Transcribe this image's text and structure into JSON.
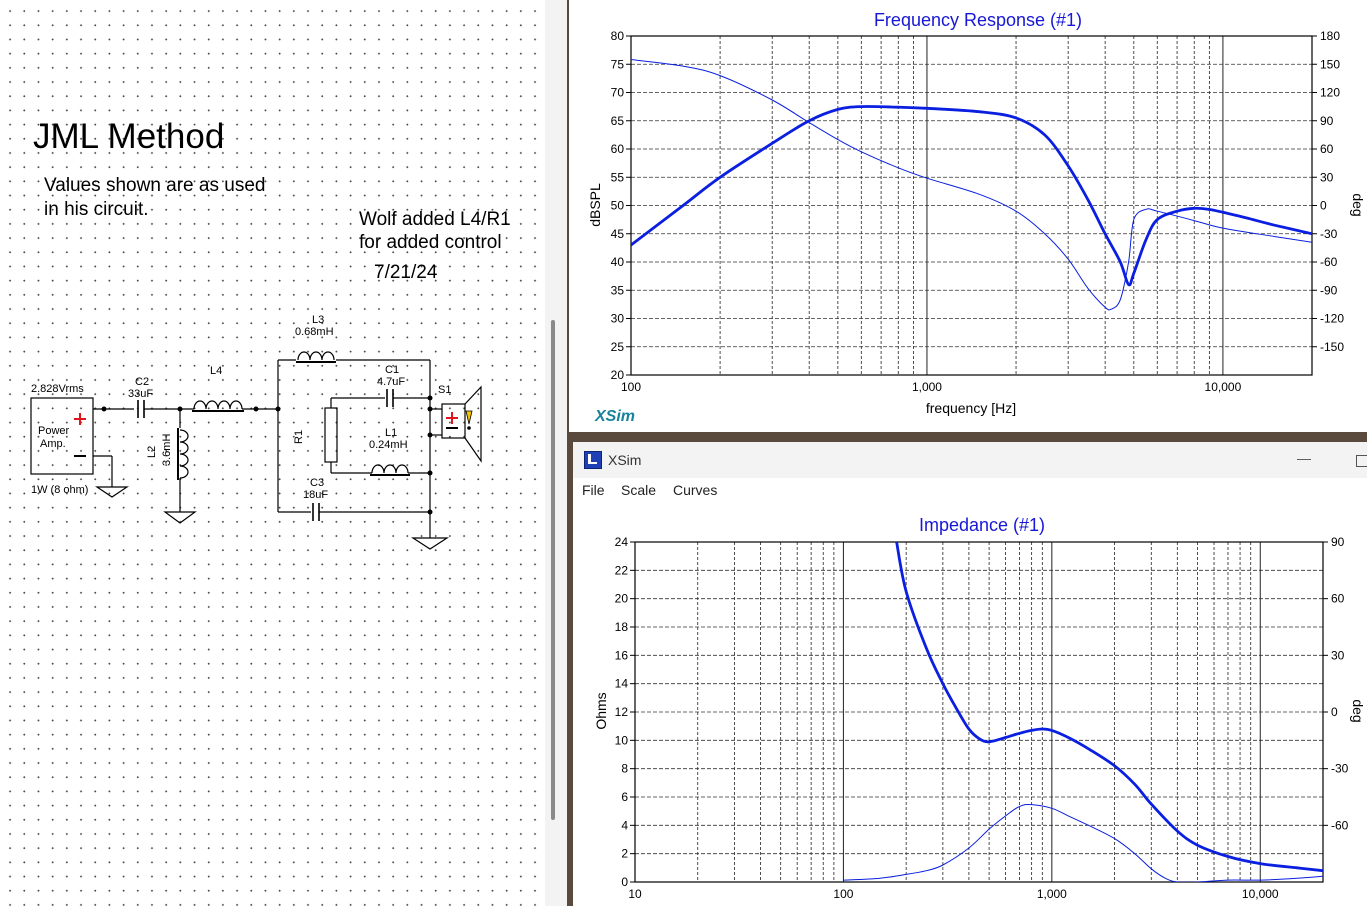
{
  "schematic": {
    "title": "JML Method",
    "note_line1": "Values shown are as used",
    "note_line2": "in his circuit.",
    "note2_line1": "Wolf added L4/R1",
    "note2_line2": "for added control",
    "date": "7/21/24",
    "source_voltage": "2.828Vrms",
    "source_label_line1": "Power",
    "source_label_line2": "Amp.",
    "source_power": "1W (8 ohm)",
    "c2_name": "C2",
    "c2_value": "33uF",
    "l4_name": "L4",
    "l2_name": "L2",
    "l2_value": "3.6mH",
    "r1_name": "R1",
    "l3_name": "L3",
    "l3_value": "0.68mH",
    "c1_name": "C1",
    "c1_value": "4.7uF",
    "l1_name": "L1",
    "l1_value": "0.24mH",
    "c3_name": "C3",
    "c3_value": "18uF",
    "s1_name": "S1"
  },
  "frequency_response": {
    "title": "Frequency Response (#1)",
    "ylabel_left": "dBSPL",
    "ylabel_right": "deg",
    "xlabel": "frequency [Hz]",
    "brand": "XSim",
    "y_ticks": [
      "80",
      "75",
      "70",
      "65",
      "60",
      "55",
      "50",
      "45",
      "40",
      "35",
      "30",
      "25",
      "20"
    ],
    "y2_ticks": [
      "180",
      "150",
      "120",
      "90",
      "60",
      "30",
      "0",
      "-30",
      "-60",
      "-90",
      "-120",
      "-150"
    ],
    "x_ticks": [
      "100",
      "1,000",
      "10,000"
    ]
  },
  "impedance_window": {
    "app_title": "XSim",
    "menu": [
      "File",
      "Scale",
      "Curves"
    ],
    "minimize": "—",
    "title": "Impedance (#1)",
    "ylabel_left": "Ohms",
    "ylabel_right": "deg",
    "y_ticks": [
      "24",
      "22",
      "20",
      "18",
      "16",
      "14",
      "12",
      "10",
      "8",
      "6",
      "4",
      "2",
      "0"
    ],
    "y2_ticks": [
      "90",
      "60",
      "30",
      "0",
      "-30",
      "-60"
    ],
    "x_ticks": [
      "10",
      "100",
      "1,000",
      "10,000"
    ]
  },
  "chart_data": [
    {
      "type": "line",
      "title": "Frequency Response (#1)",
      "xlabel": "frequency [Hz]",
      "ylabel": "dBSPL",
      "y2label": "deg",
      "xscale": "log",
      "xlim": [
        100,
        20000
      ],
      "ylim": [
        20,
        80
      ],
      "y2lim": [
        -180,
        180
      ],
      "grid": true,
      "series": [
        {
          "axis": "left",
          "style": "thick",
          "color": "#0a1fe0",
          "x": [
            100,
            150,
            200,
            300,
            400,
            500,
            600,
            800,
            1000,
            1500,
            2000,
            2500,
            3000,
            3500,
            4000,
            4500,
            4800,
            5000,
            5500,
            6000,
            7000,
            8000,
            9000,
            10000,
            12000,
            15000,
            20000
          ],
          "y": [
            43,
            50,
            55,
            61,
            65,
            67,
            67.5,
            67.4,
            67.2,
            66.6,
            65.5,
            62.5,
            57,
            51,
            45,
            40,
            36,
            38,
            44,
            47.5,
            49,
            49.5,
            49.3,
            48.8,
            47.8,
            46.5,
            45
          ]
        },
        {
          "axis": "right",
          "style": "thin",
          "color": "#0a1fe0",
          "x": [
            100,
            150,
            200,
            300,
            400,
            500,
            600,
            800,
            1000,
            1500,
            2000,
            2500,
            3000,
            3500,
            4000,
            4200,
            4500,
            4800,
            5000,
            5500,
            6000,
            8000,
            10000,
            15000,
            20000
          ],
          "y": [
            155,
            148,
            138,
            112,
            88,
            70,
            57,
            40,
            29,
            12,
            -6,
            -30,
            -57,
            -88,
            -108,
            -110,
            -100,
            -60,
            -15,
            -4,
            -6,
            -16,
            -24,
            -33,
            -39
          ]
        }
      ]
    },
    {
      "type": "line",
      "title": "Impedance (#1)",
      "ylabel": "Ohms",
      "y2label": "deg",
      "xscale": "log",
      "xlim": [
        10,
        20000
      ],
      "ylim": [
        0,
        24
      ],
      "y2lim": [
        -90,
        90
      ],
      "grid": true,
      "series": [
        {
          "axis": "left",
          "style": "thick",
          "color": "#0a1fe0",
          "x": [
            180,
            200,
            250,
            300,
            350,
            400,
            450,
            500,
            600,
            700,
            800,
            900,
            1000,
            1200,
            1500,
            2000,
            2500,
            3000,
            4000,
            5000,
            7000,
            10000,
            15000,
            20000
          ],
          "y": [
            24,
            20.5,
            16.5,
            14,
            12.2,
            10.8,
            10.1,
            9.9,
            10.2,
            10.5,
            10.7,
            10.8,
            10.7,
            10.2,
            9.4,
            8.2,
            6.9,
            5.5,
            3.6,
            2.6,
            1.8,
            1.3,
            1.0,
            0.8
          ]
        },
        {
          "axis": "right",
          "style": "thin",
          "color": "#0a1fe0",
          "x": [
            100,
            150,
            200,
            250,
            300,
            400,
            500,
            600,
            700,
            800,
            1000,
            1200,
            1500,
            2000,
            2500,
            3000,
            3500,
            4000,
            5000,
            7000,
            10000,
            15000,
            20000
          ],
          "y": [
            -89,
            -88,
            -86,
            -84,
            -81,
            -72,
            -62,
            -55,
            -50,
            -49,
            -51,
            -55,
            -60,
            -67,
            -75,
            -83,
            -88,
            -90,
            -90,
            -89,
            -89,
            -88,
            -87
          ]
        }
      ]
    }
  ]
}
